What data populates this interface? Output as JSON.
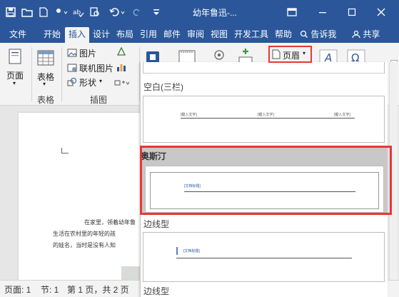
{
  "titlebar": {
    "title": "幼年鲁迅-...",
    "accent": "#2b579a"
  },
  "tabs": [
    "文件",
    "开始",
    "插入",
    "设计",
    "布局",
    "引用",
    "邮件",
    "审阅",
    "视图",
    "开发工具",
    "帮助"
  ],
  "active_tab": "插入",
  "tell_me": "告诉我",
  "share": "共享",
  "ribbon": {
    "page_btn": "页面",
    "table_btn": "表格",
    "table_group": "表格",
    "picture": "图片",
    "online_picture": "联机图片",
    "shapes": "形状",
    "illustrations_group": "插图",
    "header_btn": "页眉"
  },
  "gallery": {
    "blank_three_col": "空白(三栏)",
    "placeholder_type": "[键入文字]",
    "austin": "奥斯汀",
    "austin_placeholder": "[文档标题]",
    "sideline": "边线型",
    "sideline_placeholder": "[文档标题]",
    "sideline_2": "边线型",
    "highlight_color": "#e53935",
    "selected_bg": "#c8c8c8"
  },
  "document": {
    "line1": "在家里，领着幼年鲁",
    "line2": "生活在农村里的年轻的孩",
    "line3": "的娃名，当时是没有人知"
  },
  "status": {
    "page": "页面: 1",
    "section": "节: 1",
    "pages": "第 1 页，共 2 页"
  }
}
